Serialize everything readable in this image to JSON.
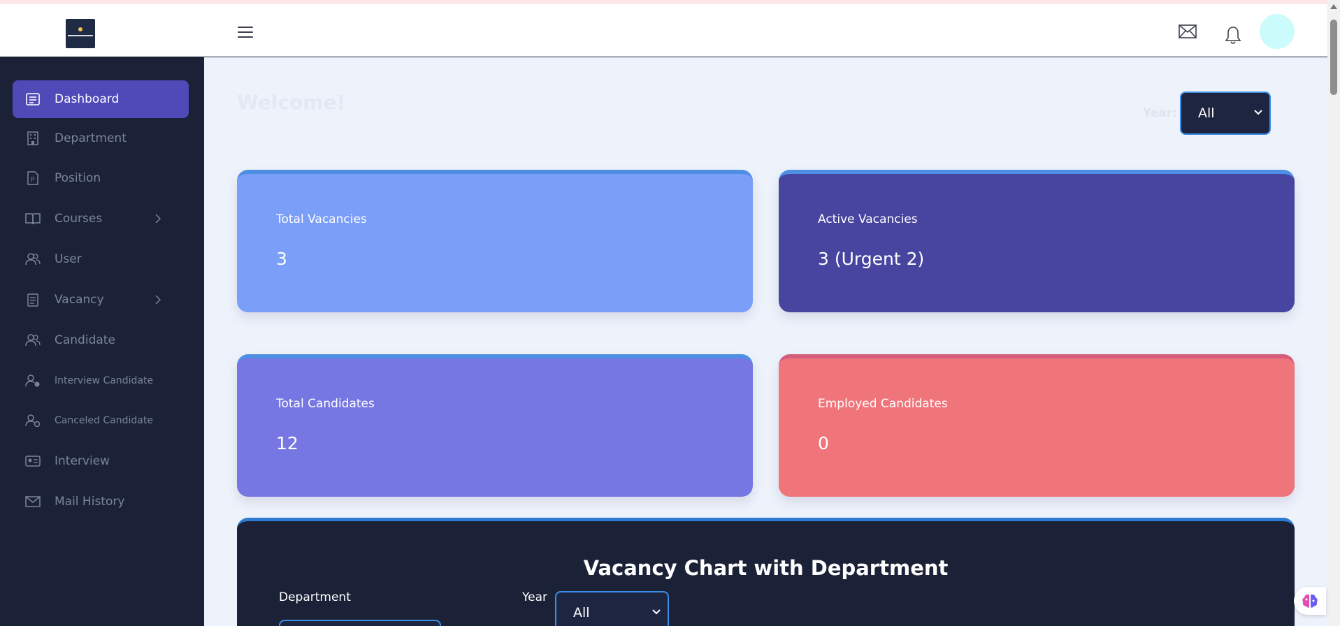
{
  "header": {
    "logo_icon": "company-logo",
    "menu_icon": "hamburger-icon",
    "mail_icon": "mail-icon",
    "bell_icon": "bell-icon"
  },
  "sidebar": {
    "items": [
      {
        "label": "Dashboard",
        "icon": "dashboard-icon",
        "active": true
      },
      {
        "label": "Department",
        "icon": "building-icon"
      },
      {
        "label": "Position",
        "icon": "document-icon"
      },
      {
        "label": "Courses",
        "icon": "book-icon",
        "has_submenu": true
      },
      {
        "label": "User",
        "icon": "users-icon"
      },
      {
        "label": "Vacancy",
        "icon": "clipboard-icon",
        "has_submenu": true
      },
      {
        "label": "Candidate",
        "icon": "users-icon"
      },
      {
        "label": "Interview Candidate",
        "icon": "user-check-icon"
      },
      {
        "label": "Canceled Candidate",
        "icon": "user-check-icon"
      },
      {
        "label": "Interview",
        "icon": "id-card-icon"
      },
      {
        "label": "Mail History",
        "icon": "mail-icon"
      }
    ]
  },
  "main": {
    "welcome": "Welcome!",
    "year_label": "Year:",
    "year_value": "All",
    "cards": [
      {
        "label": "Total Vacancies",
        "value": "3",
        "color": "#7b9ef8"
      },
      {
        "label": "Active Vacancies",
        "value": "3 (Urgent 2)",
        "color": "#4845a0"
      },
      {
        "label": "Total Candidates",
        "value": "12",
        "color": "#7677e3"
      },
      {
        "label": "Employed Candidates",
        "value": "0",
        "color": "#f0757b"
      }
    ],
    "chart_panel": {
      "title": "Vacancy Chart with Department",
      "department_label": "Department",
      "year_label": "Year",
      "year_value": "All"
    }
  },
  "colors": {
    "sidebar_bg": "#1b2238",
    "active_item": "#4f4ab8",
    "accent_border": "#3a8ee6"
  }
}
